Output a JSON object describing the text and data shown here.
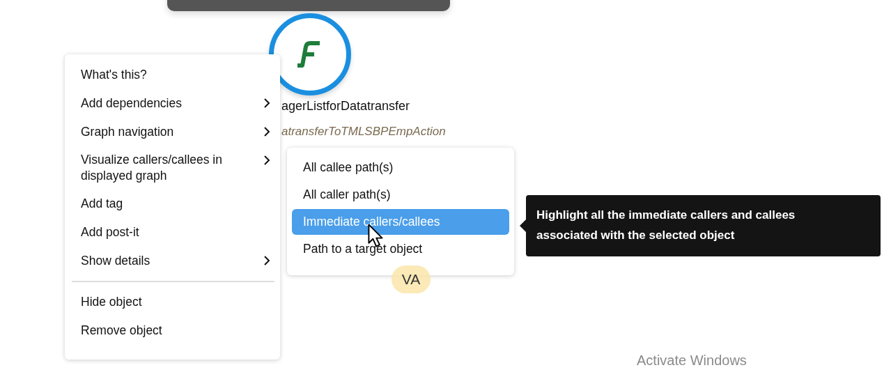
{
  "graph_node": {
    "name": "agerListforDatatransfer",
    "subtitle": "atransferToTMLSBPEmpAction"
  },
  "context_menu": {
    "sections": [
      {
        "items": [
          {
            "label": "What's this?",
            "submenu": false
          },
          {
            "label": "Add dependencies",
            "submenu": true
          },
          {
            "label": "Graph navigation",
            "submenu": true
          },
          {
            "label": "Visualize callers/callees in displayed graph",
            "submenu": true
          },
          {
            "label": "Add tag",
            "submenu": false
          },
          {
            "label": "Add post-it",
            "submenu": false
          },
          {
            "label": "Show details",
            "submenu": true
          }
        ]
      },
      {
        "items": [
          {
            "label": "Hide object",
            "submenu": false
          },
          {
            "label": "Remove object",
            "submenu": false
          }
        ]
      }
    ]
  },
  "submenu": {
    "items": [
      {
        "label": "All callee path(s)",
        "selected": false
      },
      {
        "label": "All caller path(s)",
        "selected": false
      },
      {
        "label": "Immediate callers/callees",
        "selected": true
      },
      {
        "label": "Path to a target object",
        "selected": false
      }
    ]
  },
  "tooltip": {
    "text": "Highlight all the immediate callers and callees associated with the selected object"
  },
  "user_badge": {
    "initials": "VA"
  },
  "os_notice": {
    "text": "Activate Windows"
  }
}
